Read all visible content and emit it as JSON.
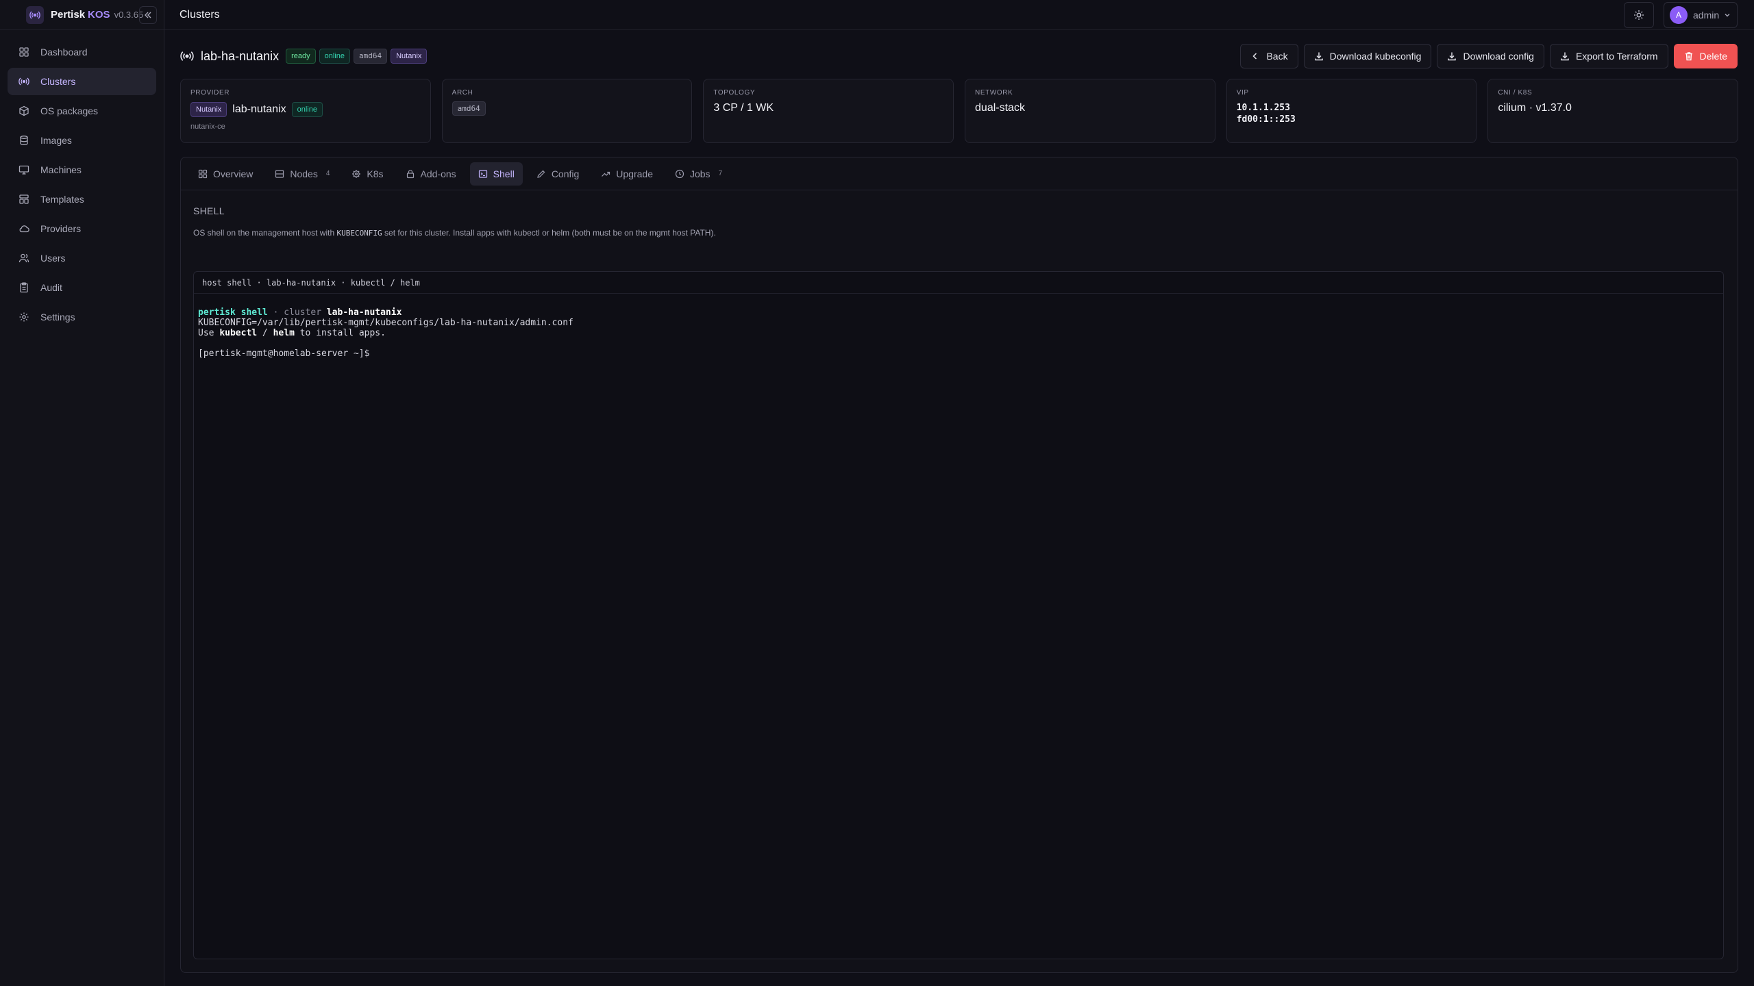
{
  "brand": {
    "name": "Pertisk",
    "product": "KOS",
    "version": "v0.3.65"
  },
  "nav": [
    {
      "label": "Dashboard",
      "icon": "dashboard-icon"
    },
    {
      "label": "Clusters",
      "icon": "cluster-icon",
      "active": true
    },
    {
      "label": "OS packages",
      "icon": "package-icon"
    },
    {
      "label": "Images",
      "icon": "database-icon"
    },
    {
      "label": "Machines",
      "icon": "monitor-icon"
    },
    {
      "label": "Templates",
      "icon": "template-icon"
    },
    {
      "label": "Providers",
      "icon": "cloud-icon"
    },
    {
      "label": "Users",
      "icon": "users-icon"
    },
    {
      "label": "Audit",
      "icon": "clipboard-icon"
    },
    {
      "label": "Settings",
      "icon": "gear-icon"
    }
  ],
  "topbar": {
    "title": "Clusters",
    "user": {
      "initial": "A",
      "name": "admin"
    }
  },
  "cluster": {
    "name": "lab-ha-nutanix",
    "badges": [
      "ready",
      "online",
      "amd64",
      "Nutanix"
    ]
  },
  "actions": {
    "back": "Back",
    "download_kubeconfig": "Download kubeconfig",
    "download_config": "Download config",
    "export_terraform": "Export to Terraform",
    "delete": "Delete"
  },
  "cards": {
    "provider": {
      "label": "PROVIDER",
      "type_badge": "Nutanix",
      "name": "lab-nutanix",
      "status": "online",
      "sub": "nutanix-ce"
    },
    "arch": {
      "label": "ARCH",
      "value": "amd64"
    },
    "topology": {
      "label": "TOPOLOGY",
      "value": "3 CP / 1 WK"
    },
    "network": {
      "label": "NETWORK",
      "value": "dual-stack"
    },
    "vip": {
      "label": "VIP",
      "ipv4": "10.1.1.253",
      "ipv6": "fd00:1::253"
    },
    "cni": {
      "label": "CNI / K8S",
      "value": "cilium · v1.37.0"
    }
  },
  "tabs": [
    {
      "label": "Overview",
      "icon": "grid-icon"
    },
    {
      "label": "Nodes",
      "icon": "server-icon",
      "count": "4"
    },
    {
      "label": "K8s",
      "icon": "helm-icon"
    },
    {
      "label": "Add-ons",
      "icon": "lock-icon"
    },
    {
      "label": "Shell",
      "icon": "terminal-icon",
      "active": true
    },
    {
      "label": "Config",
      "icon": "pencil-icon"
    },
    {
      "label": "Upgrade",
      "icon": "trend-icon"
    },
    {
      "label": "Jobs",
      "icon": "clock-icon",
      "count": "7"
    }
  ],
  "shell": {
    "title": "SHELL",
    "desc_pre": "OS shell on the management host with ",
    "desc_code": "KUBECONFIG",
    "desc_post": " set for this cluster. Install apps with kubectl or helm (both must be on the mgmt host PATH).",
    "terminal_header": "host shell · lab-ha-nutanix · kubectl / helm",
    "line1_a": "pertisk shell",
    "line1_b": " · cluster ",
    "line1_c": "lab-ha-nutanix",
    "line2": "KUBECONFIG=/var/lib/pertisk-mgmt/kubeconfigs/lab-ha-nutanix/admin.conf",
    "line3_a": "Use ",
    "line3_b": "kubectl",
    "line3_c": " / ",
    "line3_d": "helm",
    "line3_e": " to install apps.",
    "prompt": "[pertisk-mgmt@homelab-server ~]$"
  },
  "colors": {
    "accent": "#a78bfa",
    "danger": "#f05252",
    "terminal_cyan": "#5eead4"
  }
}
